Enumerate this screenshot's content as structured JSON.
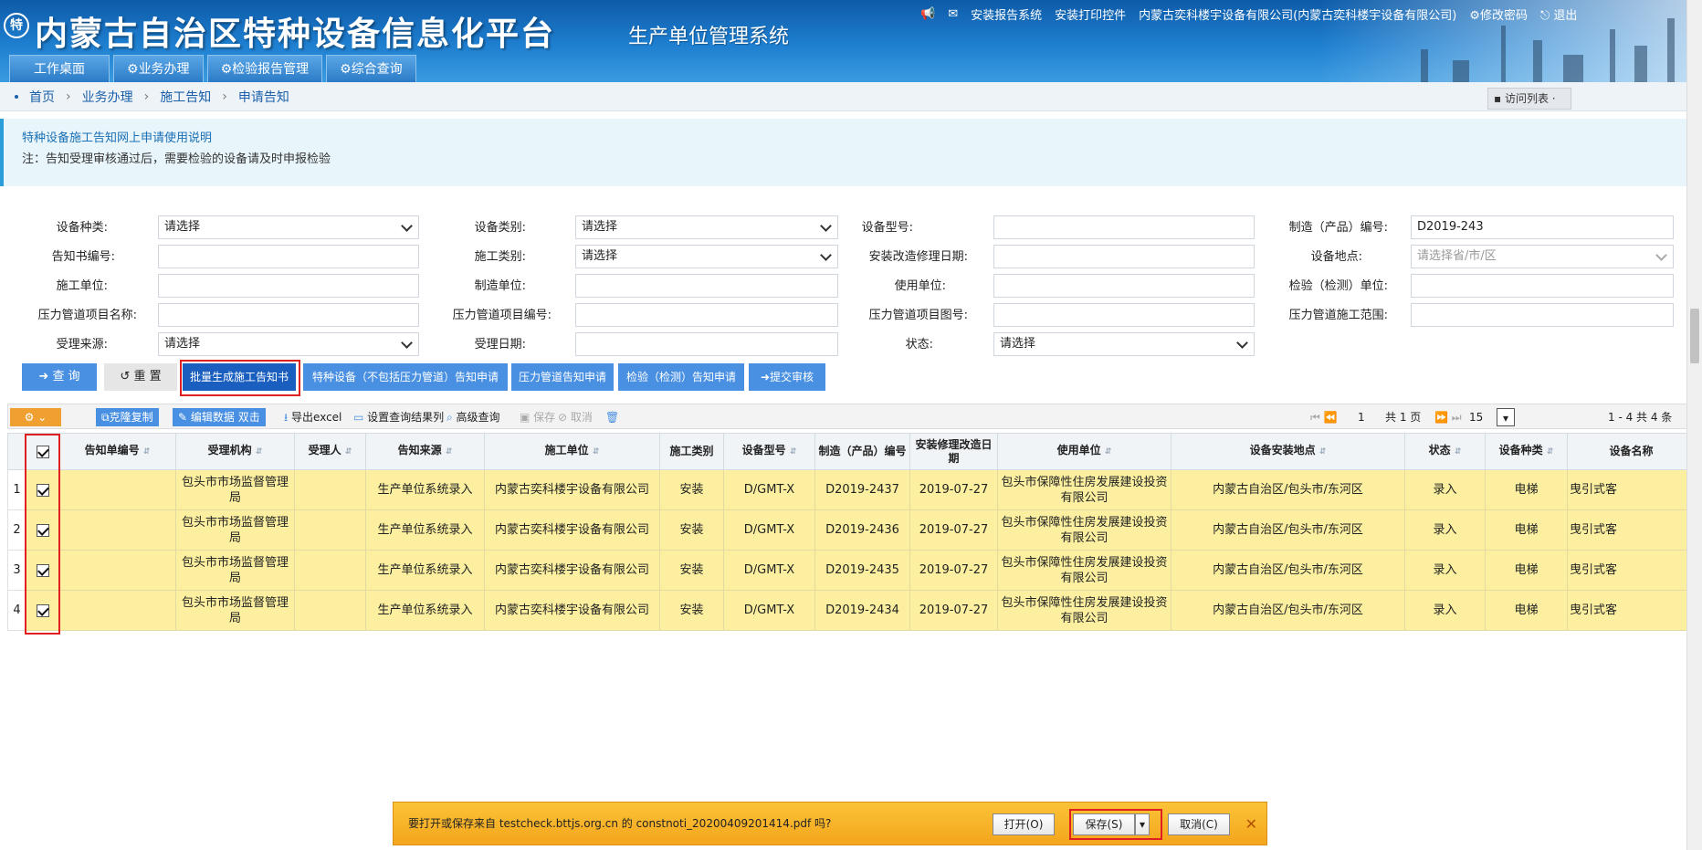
{
  "header": {
    "logo_char": "特",
    "title": "内蒙古自治区特种设备信息化平台",
    "subtitle": "生产单位管理系统",
    "links": [
      "安装报告系统",
      "安装打印控件",
      "内蒙古奕科楼宇设备有限公司(内蒙古奕科楼宇设备有限公司)",
      "修改密码",
      "退出"
    ]
  },
  "nav": {
    "tabs": [
      "工作桌面",
      "业务办理",
      "检验报告管理",
      "综合查询"
    ]
  },
  "breadcrumb": {
    "items": [
      "首页",
      "业务办理",
      "施工告知",
      "申请告知"
    ]
  },
  "visit_list": "访问列表",
  "notice": {
    "title": "特种设备施工告知网上申请使用说明",
    "note": "注：告知受理审核通过后，需要检验的设备请及时申报检验"
  },
  "form": {
    "labels": {
      "equip_type": "设备种类:",
      "equip_category": "设备类别:",
      "equip_model": "设备型号:",
      "mfg_no": "制造（产品）编号:",
      "notice_no": "告知书编号:",
      "construct_type": "施工类别:",
      "install_date": "安装改造修理日期:",
      "location": "设备地点:",
      "construct_unit": "施工单位:",
      "mfg_unit": "制造单位:",
      "use_unit": "使用单位:",
      "inspect_unit": "检验（检测）单位:",
      "pipe_name": "压力管道项目名称:",
      "pipe_no": "压力管道项目编号:",
      "pipe_drawing": "压力管道项目图号:",
      "pipe_scope": "压力管道施工范围:",
      "source": "受理来源:",
      "accept_date": "受理日期:",
      "status": "状态:"
    },
    "values": {
      "equip_type": "请选择",
      "equip_category": "请选择",
      "mfg_no": "D2019-243",
      "construct_type": "请选择",
      "location_placeholder": "请选择省/市/区",
      "source": "请选择",
      "status": "请选择"
    }
  },
  "buttons": {
    "query": "查 询",
    "reset": "重 置",
    "batch_generate": "批量生成施工告知书",
    "special_apply": "特种设备（不包括压力管道）告知申请",
    "pipe_apply": "压力管道告知申请",
    "inspect_apply": "检验（检测）告知申请",
    "submit": "提交审核"
  },
  "toolbar": {
    "clone": "克隆复制",
    "edit": "编辑数据 双击",
    "export": "导出excel",
    "set_columns": "设置查询结果列",
    "advanced": "高级查询",
    "save": "保存",
    "cancel": "取消",
    "page": "1",
    "total_pages": "共 1 页",
    "page_size": "15",
    "range": "1 - 4  共 4 条"
  },
  "table": {
    "headers": [
      "告知单编号",
      "受理机构",
      "受理人",
      "告知来源",
      "施工单位",
      "施工类别",
      "设备型号",
      "制造（产品）编号",
      "安装修理改造日期",
      "使用单位",
      "设备安装地点",
      "状态",
      "设备种类",
      "设备名称"
    ],
    "rows": [
      {
        "n": "1",
        "org": "包头市市场监督管理局",
        "source": "生产单位系统录入",
        "unit": "内蒙古奕科楼宇设备有限公司",
        "ctype": "安装",
        "model": "D/GMT-X",
        "mfg": "D2019-2437",
        "date": "2019-07-27",
        "user": "包头市保障性住房发展建设投资有限公司",
        "loc": "内蒙古自治区/包头市/东河区",
        "status": "录入",
        "kind": "电梯",
        "name": "曳引式客"
      },
      {
        "n": "2",
        "org": "包头市市场监督管理局",
        "source": "生产单位系统录入",
        "unit": "内蒙古奕科楼宇设备有限公司",
        "ctype": "安装",
        "model": "D/GMT-X",
        "mfg": "D2019-2436",
        "date": "2019-07-27",
        "user": "包头市保障性住房发展建设投资有限公司",
        "loc": "内蒙古自治区/包头市/东河区",
        "status": "录入",
        "kind": "电梯",
        "name": "曳引式客"
      },
      {
        "n": "3",
        "org": "包头市市场监督管理局",
        "source": "生产单位系统录入",
        "unit": "内蒙古奕科楼宇设备有限公司",
        "ctype": "安装",
        "model": "D/GMT-X",
        "mfg": "D2019-2435",
        "date": "2019-07-27",
        "user": "包头市保障性住房发展建设投资有限公司",
        "loc": "内蒙古自治区/包头市/东河区",
        "status": "录入",
        "kind": "电梯",
        "name": "曳引式客"
      },
      {
        "n": "4",
        "org": "包头市市场监督管理局",
        "source": "生产单位系统录入",
        "unit": "内蒙古奕科楼宇设备有限公司",
        "ctype": "安装",
        "model": "D/GMT-X",
        "mfg": "D2019-2434",
        "date": "2019-07-27",
        "user": "包头市保障性住房发展建设投资有限公司",
        "loc": "内蒙古自治区/包头市/东河区",
        "status": "录入",
        "kind": "电梯",
        "name": "曳引式客"
      }
    ]
  },
  "download": {
    "message": "要打开或保存来自 testcheck.bttjs.org.cn 的 constnoti_20200409201414.pdf 吗?",
    "open": "打开(O)",
    "save": "保存(S)",
    "cancel": "取消(C)"
  }
}
